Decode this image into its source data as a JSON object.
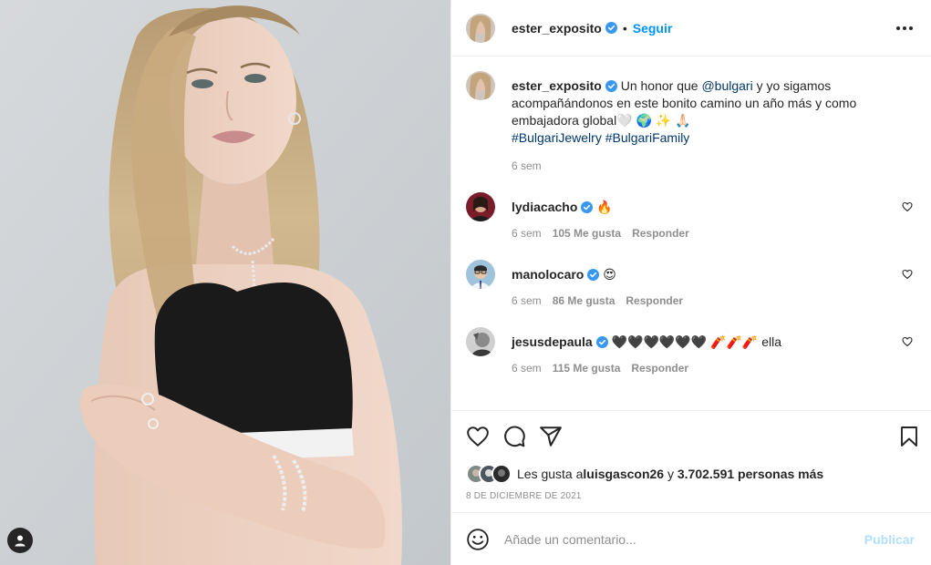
{
  "post": {
    "author": {
      "username": "ester_exposito",
      "follow_label": "Seguir",
      "separator": "•"
    },
    "caption": {
      "username": "ester_exposito",
      "text_part1": " Un honor que ",
      "mention": "@bulgari",
      "text_part2": " y yo sigamos acompañándonos en este bonito camino un año más y como embajadora global",
      "emojis": "🤍 🌍 ✨ 🙏🏻",
      "hashtag1": "#BulgariJewelry",
      "hashtag2": "#BulgariFamily",
      "time": "6 sem"
    },
    "comments": [
      {
        "username": "lydiacacho",
        "text": "🔥",
        "time": "6 sem",
        "likes": "105 Me gusta",
        "reply": "Responder"
      },
      {
        "username": "manolocaro",
        "text": "😍",
        "time": "6 sem",
        "likes": "86 Me gusta",
        "reply": "Responder"
      },
      {
        "username": "jesusdepaula",
        "text": "🖤🖤🖤🖤🖤🖤 🧨🧨🧨 ella",
        "time": "6 sem",
        "likes": "115 Me gusta",
        "reply": "Responder"
      }
    ],
    "likes": {
      "prefix": "Les gusta a ",
      "user": "luisgascon26",
      "middle": " y ",
      "count": "3.702.591 personas más"
    },
    "date": "8 DE DICIEMBRE DE 2021",
    "add_comment": {
      "placeholder": "Añade un comentario...",
      "publish_label": "Publicar"
    }
  },
  "icons": {
    "more": "more-options-icon",
    "verified": "verified-badge-icon",
    "like": "heart-icon",
    "comment": "comment-bubble-icon",
    "share": "paper-plane-icon",
    "save": "bookmark-icon",
    "emoji": "smiley-icon",
    "tag": "user-tag-icon"
  },
  "colors": {
    "accent": "#0095f6",
    "verified": "#3897f0",
    "link": "#00376b",
    "muted": "#8e8e8e",
    "publish_disabled": "#b2dffc"
  }
}
